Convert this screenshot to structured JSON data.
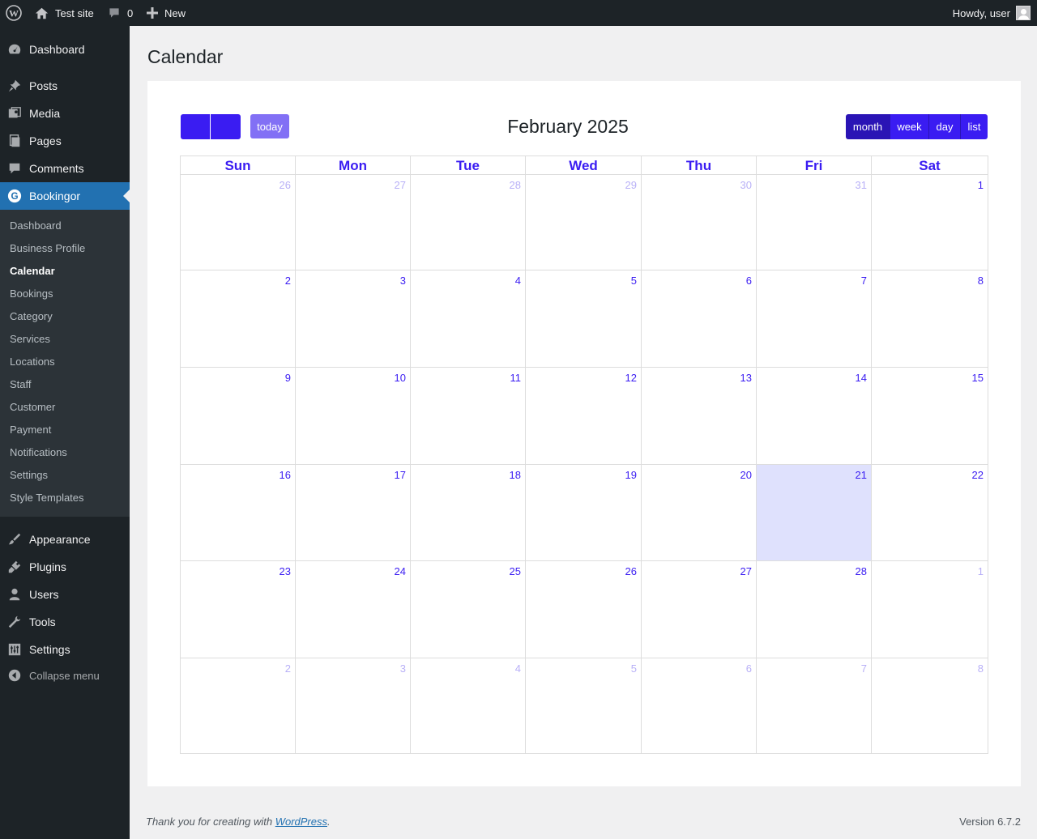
{
  "adminbar": {
    "site_name": "Test site",
    "comments_count": "0",
    "new_label": "New",
    "howdy": "Howdy, user"
  },
  "menu": {
    "top_items": [
      {
        "label": "Dashboard",
        "icon": "dashboard-icon"
      },
      {
        "label": "Posts",
        "icon": "pin-icon"
      },
      {
        "label": "Media",
        "icon": "media-icon"
      },
      {
        "label": "Pages",
        "icon": "pages-icon"
      },
      {
        "label": "Comments",
        "icon": "comment-icon"
      },
      {
        "label": "Bookingor",
        "icon": "bookingor-icon"
      }
    ],
    "submenu": [
      "Dashboard",
      "Business Profile",
      "Calendar",
      "Bookings",
      "Category",
      "Services",
      "Locations",
      "Staff",
      "Customer",
      "Payment",
      "Notifications",
      "Settings",
      "Style Templates"
    ],
    "bottom_items": [
      {
        "label": "Appearance",
        "icon": "brush-icon"
      },
      {
        "label": "Plugins",
        "icon": "plugin-icon"
      },
      {
        "label": "Users",
        "icon": "users-icon"
      },
      {
        "label": "Tools",
        "icon": "wrench-icon"
      },
      {
        "label": "Settings",
        "icon": "sliders-icon"
      }
    ],
    "collapse_label": "Collapse menu"
  },
  "page": {
    "title": "Calendar"
  },
  "calendar": {
    "title": "February 2025",
    "today_label": "today",
    "views": [
      "month",
      "week",
      "day",
      "list"
    ],
    "active_view": "month",
    "weekdays": [
      "Sun",
      "Mon",
      "Tue",
      "Wed",
      "Thu",
      "Fri",
      "Sat"
    ],
    "weeks": [
      [
        {
          "d": "26",
          "other": true
        },
        {
          "d": "27",
          "other": true
        },
        {
          "d": "28",
          "other": true
        },
        {
          "d": "29",
          "other": true
        },
        {
          "d": "30",
          "other": true
        },
        {
          "d": "31",
          "other": true
        },
        {
          "d": "1"
        }
      ],
      [
        {
          "d": "2"
        },
        {
          "d": "3"
        },
        {
          "d": "4"
        },
        {
          "d": "5"
        },
        {
          "d": "6"
        },
        {
          "d": "7"
        },
        {
          "d": "8"
        }
      ],
      [
        {
          "d": "9"
        },
        {
          "d": "10"
        },
        {
          "d": "11"
        },
        {
          "d": "12"
        },
        {
          "d": "13"
        },
        {
          "d": "14"
        },
        {
          "d": "15"
        }
      ],
      [
        {
          "d": "16"
        },
        {
          "d": "17"
        },
        {
          "d": "18"
        },
        {
          "d": "19"
        },
        {
          "d": "20"
        },
        {
          "d": "21",
          "today": true
        },
        {
          "d": "22"
        }
      ],
      [
        {
          "d": "23"
        },
        {
          "d": "24"
        },
        {
          "d": "25"
        },
        {
          "d": "26"
        },
        {
          "d": "27"
        },
        {
          "d": "28"
        },
        {
          "d": "1",
          "other": true
        }
      ],
      [
        {
          "d": "2",
          "other": true
        },
        {
          "d": "3",
          "other": true
        },
        {
          "d": "4",
          "other": true
        },
        {
          "d": "5",
          "other": true
        },
        {
          "d": "6",
          "other": true
        },
        {
          "d": "7",
          "other": true
        },
        {
          "d": "8",
          "other": true
        }
      ]
    ]
  },
  "footer": {
    "thanks_prefix": "Thank you for creating with ",
    "thanks_link": "WordPress",
    "thanks_suffix": ".",
    "version": "Version 6.7.2"
  },
  "colors": {
    "accent": "#3a1cf2",
    "accent_active": "#2a14b5",
    "today_bg": "#dfe1fd",
    "menu_bg": "#1d2327",
    "menu_current": "#2271b1"
  }
}
